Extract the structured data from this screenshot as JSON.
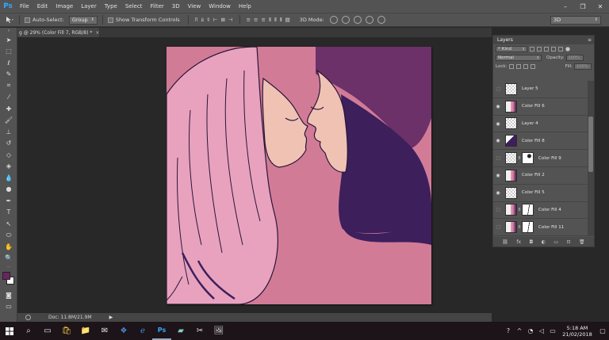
{
  "app": {
    "logo": "Ps",
    "menu": [
      "File",
      "Edit",
      "Image",
      "Layer",
      "Type",
      "Select",
      "Filter",
      "3D",
      "View",
      "Window",
      "Help"
    ],
    "window_controls": [
      "–",
      "❐",
      "✕"
    ]
  },
  "options_bar": {
    "auto_select_label": "Auto-Select:",
    "auto_select_target": "Group",
    "show_transform_label": "Show Transform Controls",
    "mode_3d_label": "3D Mode:",
    "workspace_select": "3D"
  },
  "document": {
    "tab_title": "g @ 29% (Color Fill 7, RGB/8) *",
    "tab_close": "×"
  },
  "status_bar": {
    "doc_info": "Doc: 11.8M/21.9M",
    "arrow": "▶"
  },
  "layers_panel": {
    "tab_label": "Layers",
    "filter_label": "Kind",
    "blend_mode": "Normal",
    "opacity_label": "Opacity:",
    "opacity_value": "100%",
    "lock_label": "Lock:",
    "fill_label": "Fill:",
    "fill_value": "100%",
    "layers": [
      {
        "name": "Layer 5",
        "visible": false,
        "thumb": "transparent"
      },
      {
        "name": "Color Fill 6",
        "visible": true,
        "thumb": "art"
      },
      {
        "name": "Layer 4",
        "visible": true,
        "thumb": "transparent"
      },
      {
        "name": "Color Fill 8",
        "visible": true,
        "thumb": "hair-dark"
      },
      {
        "name": "Color Fill 9",
        "visible": false,
        "thumb": "adjust-mask"
      },
      {
        "name": "Color Fill 2",
        "visible": true,
        "thumb": "art"
      },
      {
        "name": "Color Fill 5",
        "visible": true,
        "thumb": "adjust"
      },
      {
        "name": "Color Fill 4",
        "visible": false,
        "thumb": "art-mask"
      },
      {
        "name": "Color Fill 11",
        "visible": false,
        "thumb": "art-mask"
      }
    ]
  },
  "taskbar": {
    "time": "5:18 AM",
    "date": "21/02/2018"
  },
  "colors": {
    "canvas_bg": "#d27b97",
    "hair_left": "#e8a2be",
    "hair_right": "#3d1f5c",
    "hat": "#6b3168",
    "skin": "#f0c2b4",
    "foreground_swatch": "#6b2460"
  }
}
